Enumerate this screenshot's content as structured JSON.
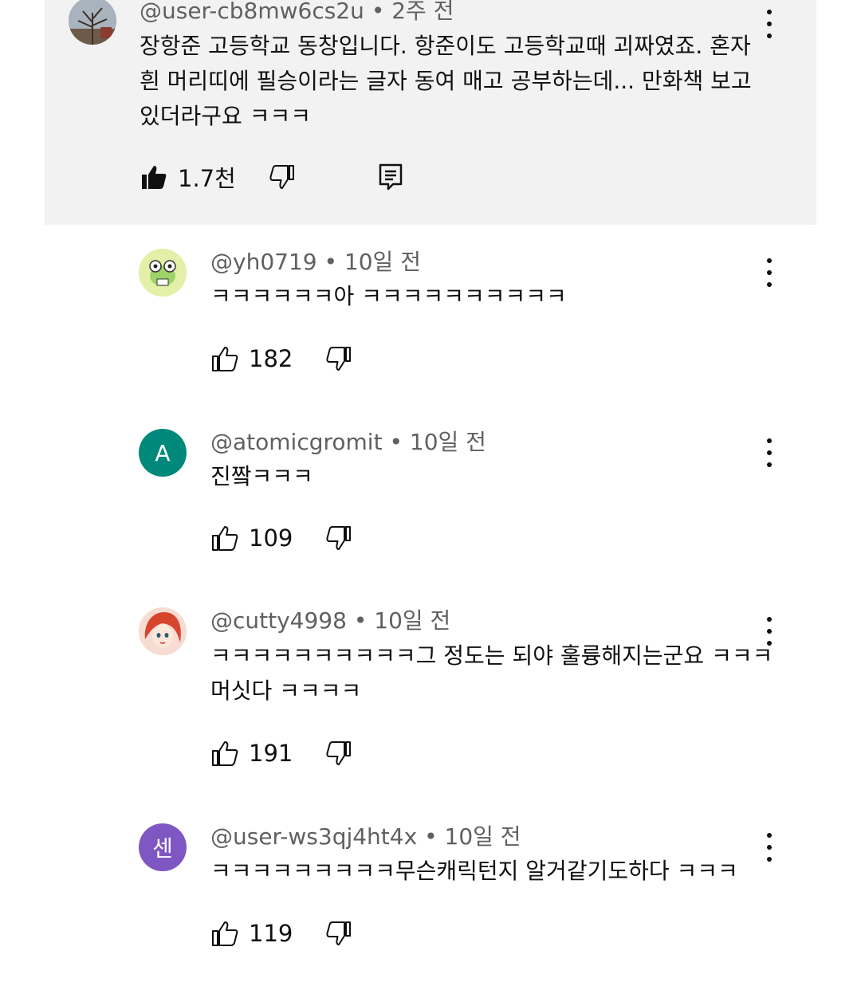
{
  "top_comment": {
    "username": "@user-cb8mw6cs2u",
    "time": "2주 전",
    "lines": [
      "장항준 고등학교 동창입니다. 항준이도 고등학교때 괴짜였죠. 혼자",
      "흰 머리띠에 필승이라는 글자 동여 매고 공부하는데... 만화책 보고",
      "있더라구요 ㅋㅋㅋ"
    ],
    "likes": "1.7천"
  },
  "replies": [
    {
      "username": "@yh0719",
      "time": "10일 전",
      "lines": [
        "ㅋㅋㅋㅋㅋㅋ아 ㅋㅋㅋㅋㅋㅋㅋㅋㅋㅋ"
      ],
      "likes": "182"
    },
    {
      "username": "@atomicgromit",
      "time": "10일 전",
      "lines": [
        "진짴ㅋㅋㅋ"
      ],
      "likes": "109",
      "avatar_letter": "A"
    },
    {
      "username": "@cutty4998",
      "time": "10일 전",
      "lines": [
        "ㅋㅋㅋㅋㅋㅋㅋㅋㅋㅋ그 정도는 되야 훌륭해지는군요 ㅋㅋㅋ",
        "머싯다 ㅋㅋㅋㅋ"
      ],
      "likes": "191"
    },
    {
      "username": "@user-ws3qj4ht4x",
      "time": "10일 전",
      "lines": [
        "ㅋㅋㅋㅋㅋㅋㅋㅋㅋ무슨캐릭턴지 알거같기도하다 ㅋㅋㅋ"
      ],
      "likes": "119",
      "avatar_letter": "센"
    }
  ],
  "separator": "•",
  "colors": {
    "top_bg": "#f2f2f2",
    "meta_text": "#606060",
    "avatar_A": "#00897b",
    "avatar_sen": "#7e57c2"
  },
  "icons": [
    "like-filled-icon",
    "like-outline-icon",
    "dislike-icon",
    "reply-icon",
    "more-vert-icon"
  ]
}
